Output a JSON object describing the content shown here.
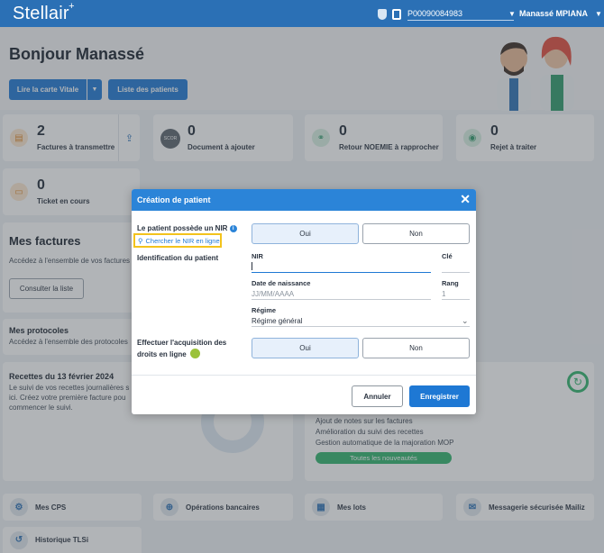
{
  "app": {
    "logo": "Stellair",
    "account_id": "P00090084983",
    "user_name": "Manassé MPIANA"
  },
  "page": {
    "greeting": "Bonjour Manassé",
    "buttons": {
      "read_card": "Lire la carte Vitale",
      "patient_list": "Liste des patients"
    },
    "stats": [
      {
        "count": "2",
        "label": "Factures à transmettre"
      },
      {
        "count": "0",
        "label": "Document à ajouter",
        "icon_text": "SCOR"
      },
      {
        "count": "0",
        "label": "Retour NOEMIE à rapprocher"
      },
      {
        "count": "0",
        "label": "Rejet à traiter"
      },
      {
        "count": "0",
        "label": "Ticket en cours"
      }
    ],
    "factures": {
      "title": "Mes factures",
      "desc": "Accédez à l'ensemble de vos factures",
      "button": "Consulter la liste"
    },
    "protocoles": {
      "title": "Mes protocoles",
      "desc": "Accédez à l'ensemble des protocoles"
    },
    "recettes": {
      "title": "Recettes du 13 février 2024",
      "desc": "Le suivi de vos recettes journalières s ici. Créez votre première facture pou commencer le suivi."
    },
    "news": {
      "items": [
        "Ajout de notes sur les factures",
        "Amélioration du suivi des recettes",
        "Gestion automatique de la majoration MOP"
      ],
      "button": "Toutes les nouveautés"
    },
    "bottom": [
      "Mes CPS",
      "Opérations bancaires",
      "Mes lots",
      "Messagerie sécurisée Mailiz",
      "Historique TLSi"
    ]
  },
  "modal": {
    "title": "Création de patient",
    "nir_question": "Le patient possède un NIR",
    "nir_link": "Chercher le NIR en ligne",
    "yes": "Oui",
    "no": "Non",
    "identification": "Identification du patient",
    "nir_label": "NIR",
    "cle_label": "Clé",
    "dob_label": "Date de naissance",
    "dob_placeholder": "JJ/MM/AAAA",
    "rang_label": "Rang",
    "rang_value": "1",
    "regime_label": "Régime",
    "regime_value": "Régime général",
    "acquisition_label_1": "Effectuer l'acquisition des",
    "acquisition_label_2": "droits en ligne",
    "cancel": "Annuler",
    "save": "Enregistrer"
  },
  "colors": {
    "brand": "#2b70b5",
    "primary": "#1e78d4",
    "highlight": "#f3c31c",
    "success": "#2fb36b"
  }
}
